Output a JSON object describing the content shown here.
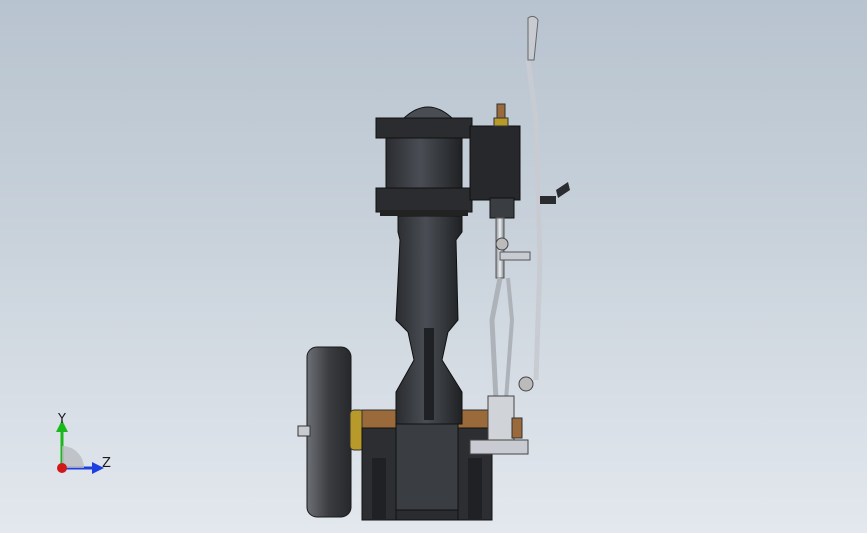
{
  "viewport": {
    "background_top": "#b7c3cf",
    "background_bottom": "#e3e8ee"
  },
  "triad": {
    "y_label": "Y",
    "z_label": "Z",
    "y_color": "#1bb81b",
    "z_color": "#1d3fe0",
    "x_color": "#d01818"
  },
  "model": {
    "part_dark": "#2a2c30",
    "part_mid": "#3a3d42",
    "part_light": "#55595f",
    "steel": "#c8ccd2",
    "bronze": "#9a6a3a",
    "brass": "#b89a2a"
  }
}
